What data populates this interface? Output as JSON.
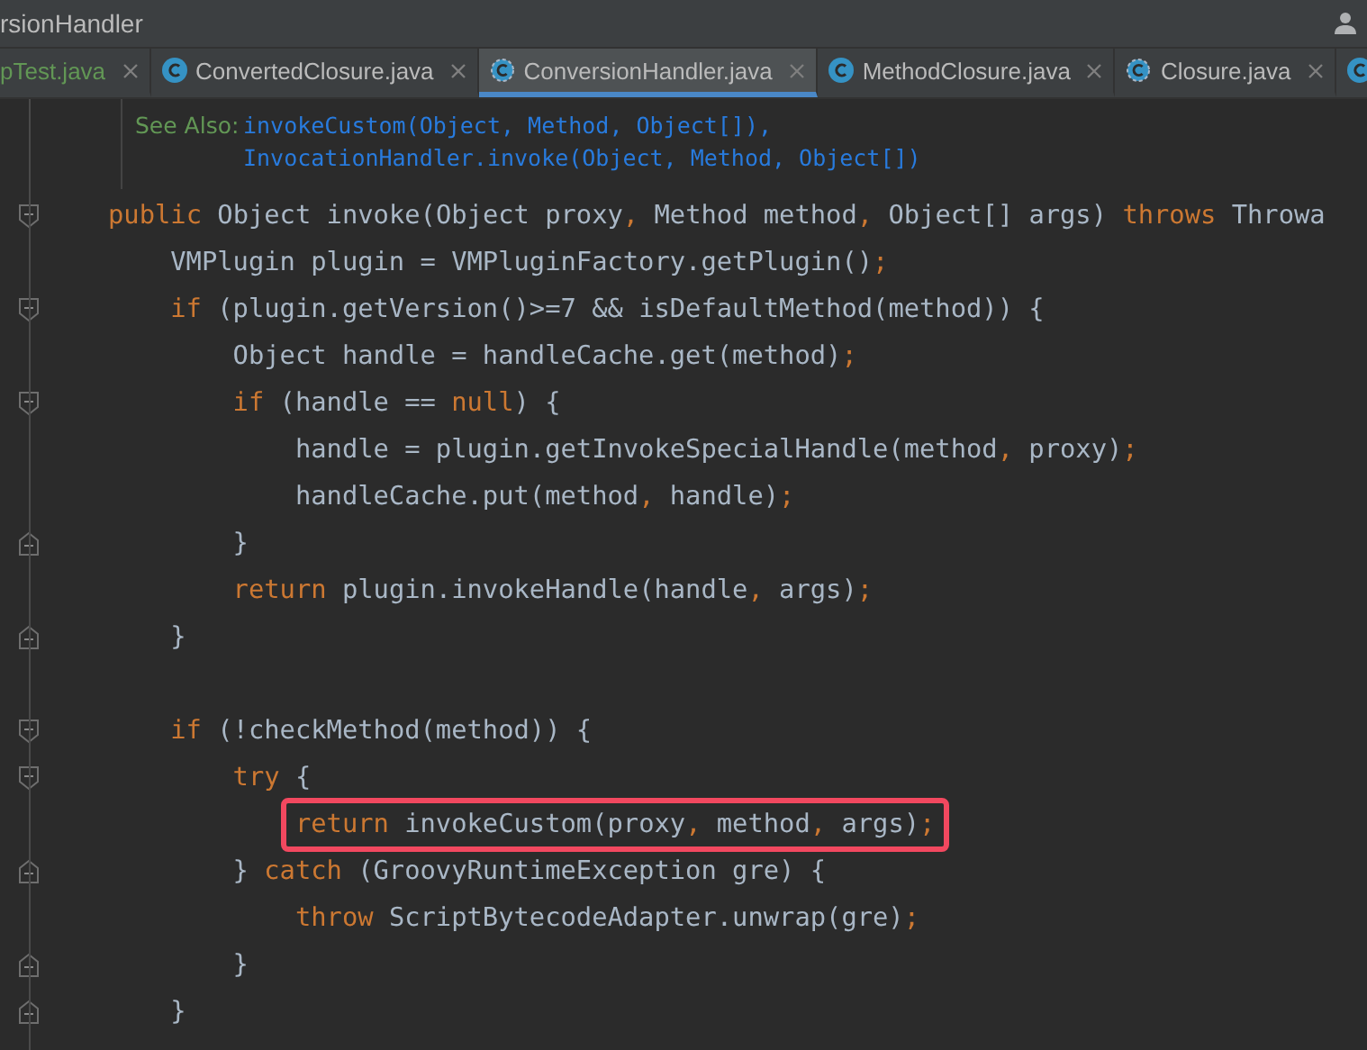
{
  "window": {
    "title": "rsionHandler"
  },
  "tabs": [
    {
      "label": "pTest.java",
      "selected": false,
      "color": "#629755",
      "kind": "plain"
    },
    {
      "label": "ConvertedClosure.java",
      "selected": false,
      "color": "#bbbbbb",
      "kind": "class"
    },
    {
      "label": "ConversionHandler.java",
      "selected": true,
      "color": "#bbbbbb",
      "kind": "abstract"
    },
    {
      "label": "MethodClosure.java",
      "selected": false,
      "color": "#bbbbbb",
      "kind": "class"
    },
    {
      "label": "Closure.java",
      "selected": false,
      "color": "#bbbbbb",
      "kind": "abstract"
    },
    {
      "selected": false,
      "kind": "partial"
    }
  ],
  "doc": {
    "label": "See Also:",
    "links": [
      "invokeCustom(Object, Method, Object[]),",
      "InvocationHandler.invoke(Object, Method, Object[])"
    ]
  },
  "code": [
    {
      "kind": "opener",
      "highlighted": false,
      "segments": [
        {
          "kind": "kw",
          "text": "public "
        },
        {
          "kind": "id",
          "text": "Object invoke(Object proxy"
        },
        {
          "kind": "kw",
          "text": ", "
        },
        {
          "kind": "id",
          "text": "Method method"
        },
        {
          "kind": "kw",
          "text": ", "
        },
        {
          "kind": "id",
          "text": "Object[] args) "
        },
        {
          "kind": "kw",
          "text": "throws "
        },
        {
          "kind": "id",
          "text": "Throwa"
        }
      ]
    },
    {
      "kind": "line",
      "highlighted": false,
      "segments": [
        {
          "kind": "id",
          "text": "    VMPlugin plugin = VMPluginFactory.getPlugin()"
        },
        {
          "kind": "kw",
          "text": ";"
        }
      ]
    },
    {
      "kind": "opener",
      "highlighted": false,
      "segments": [
        {
          "kind": "kw",
          "text": "    if "
        },
        {
          "kind": "id",
          "text": "(plugin.getVersion()>=7 && isDefaultMethod(method)) {"
        }
      ]
    },
    {
      "kind": "line",
      "highlighted": false,
      "segments": [
        {
          "kind": "id",
          "text": "        Object handle = handleCache.get(method)"
        },
        {
          "kind": "kw",
          "text": ";"
        }
      ]
    },
    {
      "kind": "opener",
      "highlighted": false,
      "segments": [
        {
          "kind": "kw",
          "text": "        if "
        },
        {
          "kind": "id",
          "text": "(handle == "
        },
        {
          "kind": "kw",
          "text": "null"
        },
        {
          "kind": "id",
          "text": ") {"
        }
      ]
    },
    {
      "kind": "line",
      "highlighted": false,
      "segments": [
        {
          "kind": "id",
          "text": "            handle = plugin.getInvokeSpecialHandle(method"
        },
        {
          "kind": "kw",
          "text": ", "
        },
        {
          "kind": "id",
          "text": "proxy)"
        },
        {
          "kind": "kw",
          "text": ";"
        }
      ]
    },
    {
      "kind": "line",
      "highlighted": false,
      "segments": [
        {
          "kind": "id",
          "text": "            handleCache.put(method"
        },
        {
          "kind": "kw",
          "text": ", "
        },
        {
          "kind": "id",
          "text": "handle)"
        },
        {
          "kind": "kw",
          "text": ";"
        }
      ]
    },
    {
      "kind": "closer",
      "highlighted": false,
      "segments": [
        {
          "kind": "id",
          "text": "        }"
        }
      ]
    },
    {
      "kind": "line",
      "highlighted": false,
      "segments": [
        {
          "kind": "kw",
          "text": "        return "
        },
        {
          "kind": "id",
          "text": "plugin.invokeHandle(handle"
        },
        {
          "kind": "kw",
          "text": ", "
        },
        {
          "kind": "id",
          "text": "args)"
        },
        {
          "kind": "kw",
          "text": ";"
        }
      ]
    },
    {
      "kind": "closer",
      "highlighted": false,
      "segments": [
        {
          "kind": "id",
          "text": "    }"
        }
      ]
    },
    {
      "kind": "line",
      "highlighted": false
    },
    {
      "kind": "opener",
      "highlighted": false,
      "segments": [
        {
          "kind": "kw",
          "text": "    if "
        },
        {
          "kind": "id",
          "text": "(!checkMethod(method)) {"
        }
      ]
    },
    {
      "kind": "opener",
      "highlighted": false,
      "segments": [
        {
          "kind": "kw",
          "text": "        try "
        },
        {
          "kind": "id",
          "text": "{"
        }
      ]
    },
    {
      "kind": "line",
      "highlighted": true,
      "segments": [
        {
          "kind": "kw",
          "text": "            return "
        },
        {
          "kind": "id",
          "text": "invokeCustom(proxy"
        },
        {
          "kind": "kw",
          "text": ", "
        },
        {
          "kind": "id",
          "text": "method"
        },
        {
          "kind": "kw",
          "text": ", "
        },
        {
          "kind": "id",
          "text": "args)"
        },
        {
          "kind": "kw",
          "text": ";"
        }
      ]
    },
    {
      "kind": "closer",
      "highlighted": false,
      "segments": [
        {
          "kind": "id",
          "text": "        } "
        },
        {
          "kind": "kw",
          "text": "catch "
        },
        {
          "kind": "id",
          "text": "(GroovyRuntimeException gre) {"
        }
      ]
    },
    {
      "kind": "line",
      "highlighted": false,
      "segments": [
        {
          "kind": "kw",
          "text": "            throw "
        },
        {
          "kind": "id",
          "text": "ScriptBytecodeAdapter.unwrap(gre)"
        },
        {
          "kind": "kw",
          "text": ";"
        }
      ]
    },
    {
      "kind": "closer",
      "highlighted": false,
      "segments": [
        {
          "kind": "id",
          "text": "        }"
        }
      ]
    },
    {
      "kind": "closer",
      "highlighted": false,
      "segments": [
        {
          "kind": "id",
          "text": "    }"
        }
      ]
    }
  ]
}
